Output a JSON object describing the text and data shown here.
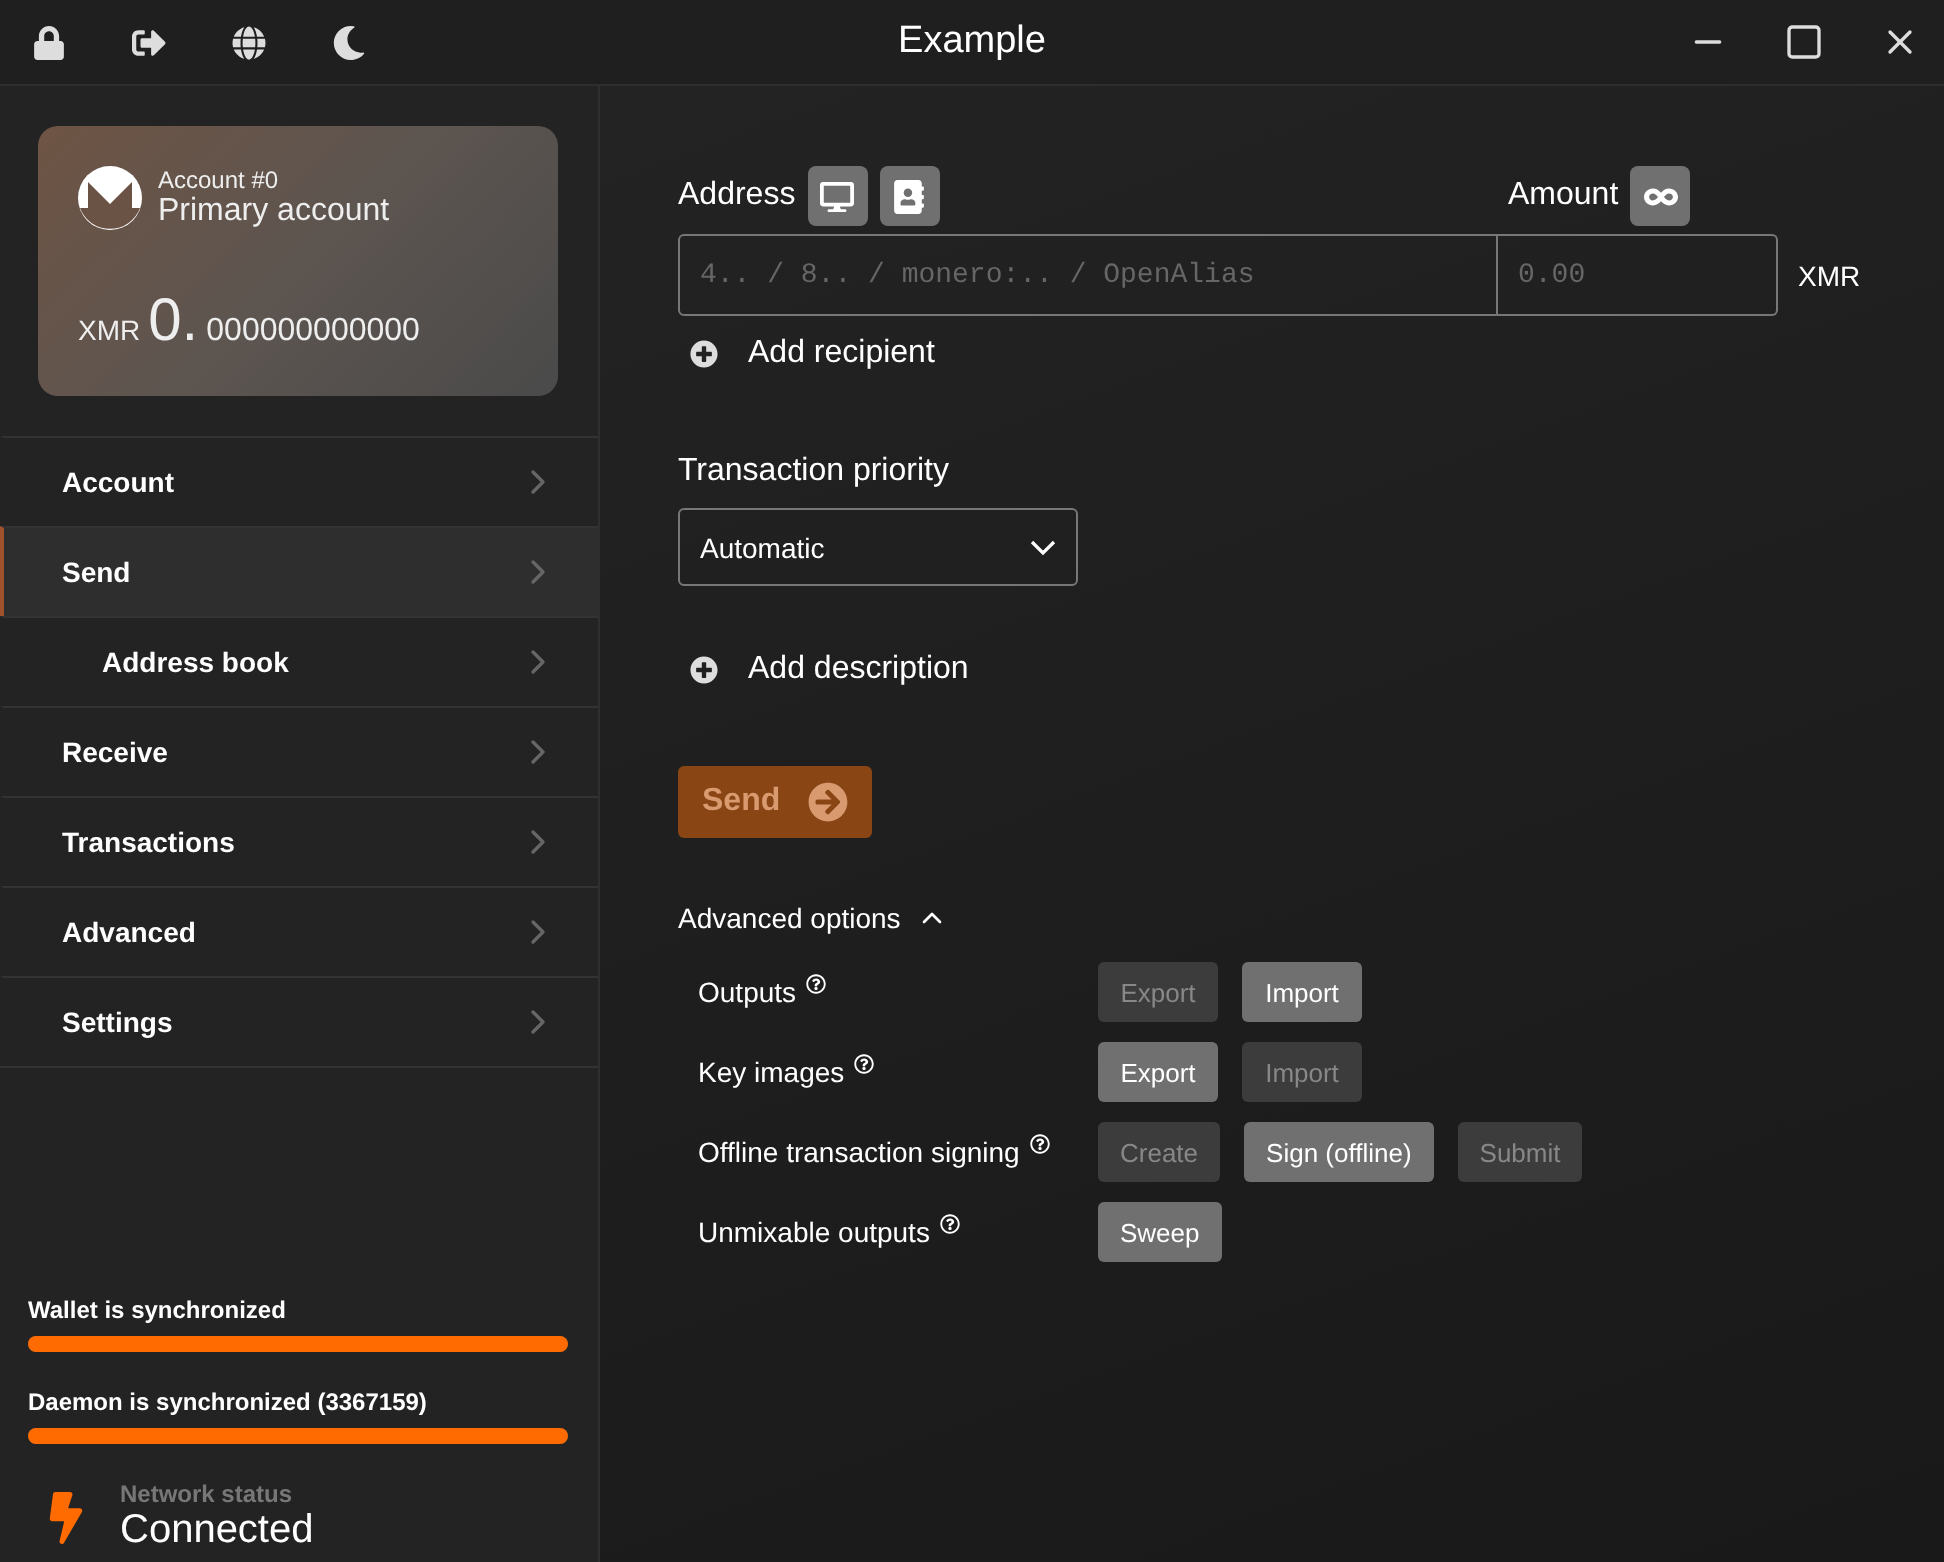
{
  "window": {
    "title": "Example"
  },
  "toolbar": [
    {
      "kind": "lock"
    },
    {
      "kind": "logout"
    },
    {
      "kind": "globe"
    },
    {
      "kind": "moon"
    }
  ],
  "account_card": {
    "label": "Account #0",
    "name": "Primary account",
    "currency": "XMR",
    "balance_int": "0.",
    "balance_frac": "000000000000"
  },
  "nav": [
    {
      "label": "Account",
      "selected": false
    },
    {
      "label": "Send",
      "selected": true,
      "children": [
        {
          "label": "Address book",
          "selected": false
        }
      ]
    },
    {
      "label": "Receive",
      "selected": false
    },
    {
      "label": "Transactions",
      "selected": false
    },
    {
      "label": "Advanced",
      "selected": false
    },
    {
      "label": "Settings",
      "selected": false
    }
  ],
  "sync": [
    {
      "label": "Wallet is synchronized",
      "level": 1
    },
    {
      "label": "Daemon is synchronized (3367159)",
      "level": 1
    }
  ],
  "network": {
    "label": "Network status",
    "value": "Connected"
  },
  "form": {
    "address_label": "Address",
    "address_placeholder": "4.. / 8.. / monero:.. / OpenAlias",
    "amount_label": "Amount",
    "amount_placeholder": "0.00",
    "currency": "XMR",
    "add_recipient": "Add recipient",
    "priority_label": "Transaction priority",
    "priority_value": "Automatic",
    "add_description": "Add description",
    "send": {
      "label": "Send",
      "disabled": true
    }
  },
  "advanced": {
    "label": "Advanced options",
    "expanded": true,
    "rows": [
      {
        "label": "Outputs",
        "buttons": [
          {
            "label": "Export",
            "disabled": true
          },
          {
            "label": "Import",
            "disabled": false
          }
        ]
      },
      {
        "label": "Key images",
        "buttons": [
          {
            "label": "Export",
            "disabled": false
          },
          {
            "label": "Import",
            "disabled": true
          }
        ]
      },
      {
        "label": "Offline transaction signing",
        "buttons": [
          {
            "label": "Create",
            "disabled": true
          },
          {
            "label": "Sign (offline)",
            "disabled": false
          },
          {
            "label": "Submit",
            "disabled": true
          }
        ]
      },
      {
        "label": "Unmixable outputs",
        "buttons": [
          {
            "label": "Sweep",
            "disabled": false
          }
        ]
      }
    ]
  }
}
